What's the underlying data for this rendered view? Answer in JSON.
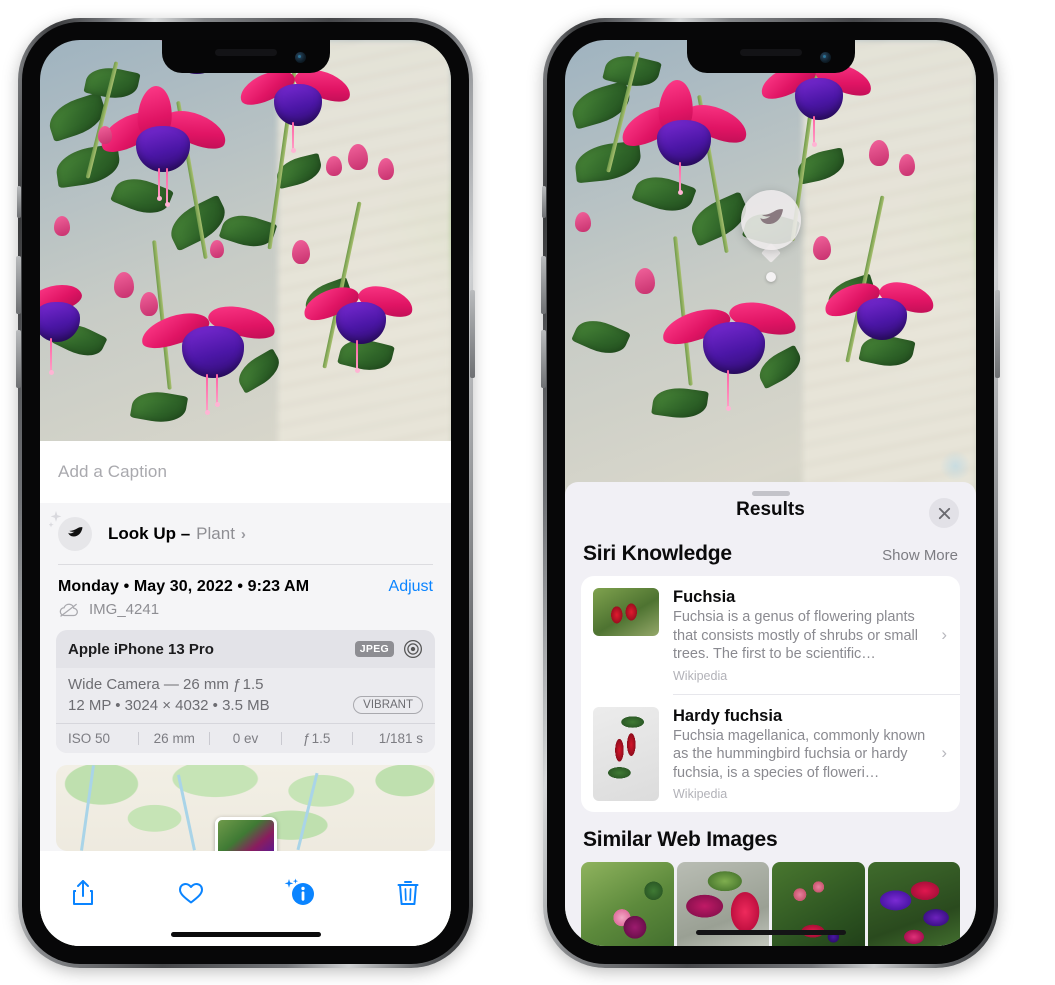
{
  "left_phone": {
    "caption_field": {
      "placeholder": "Add a Caption",
      "value": ""
    },
    "lookup": {
      "label": "Look Up –",
      "subject": "Plant",
      "chevron": "›",
      "icon": "leaf-icon"
    },
    "date_line": "Monday • May 30, 2022 • 9:23 AM",
    "adjust_label": "Adjust",
    "file_name": "IMG_4241",
    "cloud_icon": "cloud-slash-icon",
    "metadata": {
      "device": "Apple iPhone 13 Pro",
      "format_badge": "JPEG",
      "lens_icon": "aperture-icon",
      "lens_line": "Wide Camera — 26 mm ƒ 1.5",
      "resolution_line": "12 MP • 3024 × 4032 • 3.5 MB",
      "style_badge": "VIBRANT",
      "exif": [
        "ISO 50",
        "26 mm",
        "0 ev",
        "ƒ 1.5",
        "1/181 s"
      ]
    },
    "toolbar": [
      {
        "name": "share-icon",
        "label": "Share"
      },
      {
        "name": "heart-icon",
        "label": "Favorite"
      },
      {
        "name": "info-icon",
        "label": "Info",
        "active": true
      },
      {
        "name": "trash-icon",
        "label": "Delete"
      }
    ]
  },
  "right_phone": {
    "photo_badge": {
      "icon": "leaf-icon"
    },
    "results_title": "Results",
    "close_icon": "close-icon",
    "siri_knowledge": {
      "section_title": "Siri Knowledge",
      "show_more": "Show More",
      "items": [
        {
          "title": "Fuchsia",
          "description": "Fuchsia is a genus of flowering plants that consists mostly of shrubs or small trees. The first to be scientific…",
          "source": "Wikipedia",
          "chevron": "›"
        },
        {
          "title": "Hardy fuchsia",
          "description": "Fuchsia magellanica, commonly known as the hummingbird fuchsia or hardy fuchsia, is a species of floweri…",
          "source": "Wikipedia",
          "chevron": "›"
        }
      ]
    },
    "similar_web_images": {
      "section_title": "Similar Web Images",
      "thumbnails": [
        {
          "name": "web-image-1"
        },
        {
          "name": "web-image-2"
        },
        {
          "name": "web-image-3"
        },
        {
          "name": "web-image-4"
        }
      ]
    }
  },
  "colors": {
    "accent_blue": "#0a84ff",
    "sheet_bg": "#f1f0f5",
    "card_bg": "#ffffff",
    "muted_text": "#8e8e93"
  }
}
